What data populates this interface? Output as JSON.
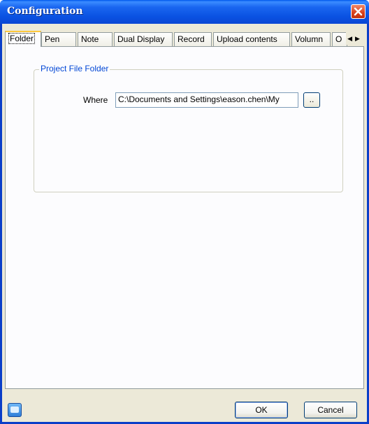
{
  "window": {
    "title": "Configuration"
  },
  "tabs": [
    {
      "label": "Folder",
      "active": true
    },
    {
      "label": "Pen"
    },
    {
      "label": "Note"
    },
    {
      "label": "Dual Display"
    },
    {
      "label": "Record"
    },
    {
      "label": "Upload contents"
    },
    {
      "label": "Volumn"
    },
    {
      "label": "O"
    }
  ],
  "tab_scroll": {
    "left": "◀",
    "right": "▶"
  },
  "folder_page": {
    "group_title": "Project File Folder",
    "where_label": "Where",
    "path_value": "C:\\Documents and Settings\\eason.chen\\My",
    "browse_label": ".."
  },
  "footer": {
    "ok_label": "OK",
    "cancel_label": "Cancel"
  },
  "colors": {
    "titlebar": "#0a52e2",
    "group_title": "#0046d5",
    "active_tab_accent": "#ffc83c"
  }
}
